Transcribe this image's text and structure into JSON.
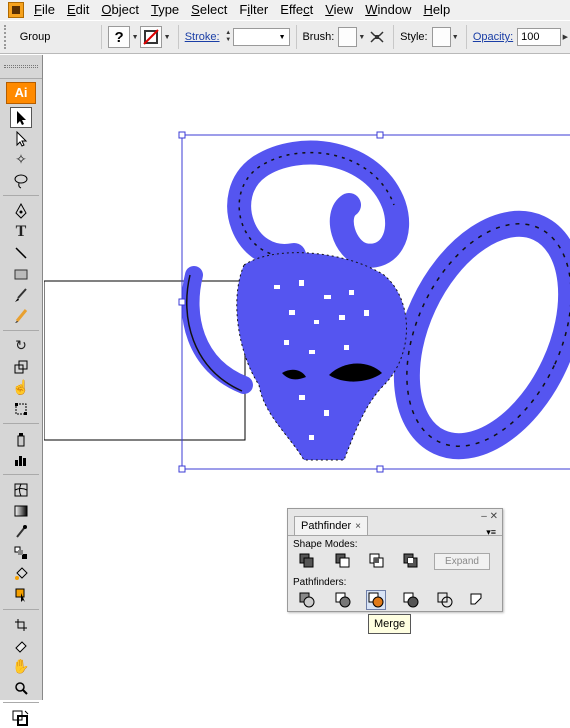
{
  "menu": {
    "items": [
      {
        "label": "File",
        "accel": "F",
        "rest": "ile"
      },
      {
        "label": "Edit",
        "accel": "E",
        "rest": "dit"
      },
      {
        "label": "Object",
        "accel": "O",
        "rest": "bject"
      },
      {
        "label": "Type",
        "accel": "T",
        "rest": "ype"
      },
      {
        "label": "Select",
        "accel": "S",
        "rest": "elect"
      },
      {
        "label": "Filter",
        "accel": "i",
        "rest": "Filter"
      },
      {
        "label": "Effect",
        "accel": "c",
        "rest": "Effect"
      },
      {
        "label": "View",
        "accel": "V",
        "rest": "iew"
      },
      {
        "label": "Window",
        "accel": "W",
        "rest": "indow"
      },
      {
        "label": "Help",
        "accel": "H",
        "rest": "elp"
      }
    ]
  },
  "controlbar": {
    "selection_label": "Group",
    "fill_glyph": "?",
    "stroke_label": "Stroke:",
    "brush_label": "Brush:",
    "style_label": "Style:",
    "opacity_label": "Opacity:",
    "opacity_value": "100"
  },
  "tools": {
    "logo": "Ai",
    "icons": [
      "selection-tool",
      "direct-selection-tool",
      "magic-wand-tool",
      "lasso-tool",
      "pen-tool",
      "type-tool",
      "line-segment-tool",
      "rectangle-tool",
      "paintbrush-tool",
      "pencil-tool",
      "rotate-tool",
      "scale-tool",
      "warp-tool",
      "free-transform-tool",
      "symbol-sprayer-tool",
      "column-graph-tool",
      "mesh-tool",
      "gradient-tool",
      "eyedropper-tool",
      "blend-tool",
      "live-paint-bucket-tool",
      "live-paint-selection-tool",
      "slice-tool",
      "eraser-tool",
      "hand-tool",
      "zoom-tool"
    ]
  },
  "pathfinder": {
    "tab_label": "Pathfinder",
    "close_glyph": "×",
    "shape_modes_label": "Shape Modes:",
    "expand_label": "Expand",
    "pathfinders_label": "Pathfinders:",
    "tooltip": "Merge"
  },
  "colors": {
    "selection_blue": "#3b3bd6",
    "artwork_fill": "#5555f0",
    "ai_orange": "#ff8a00"
  }
}
